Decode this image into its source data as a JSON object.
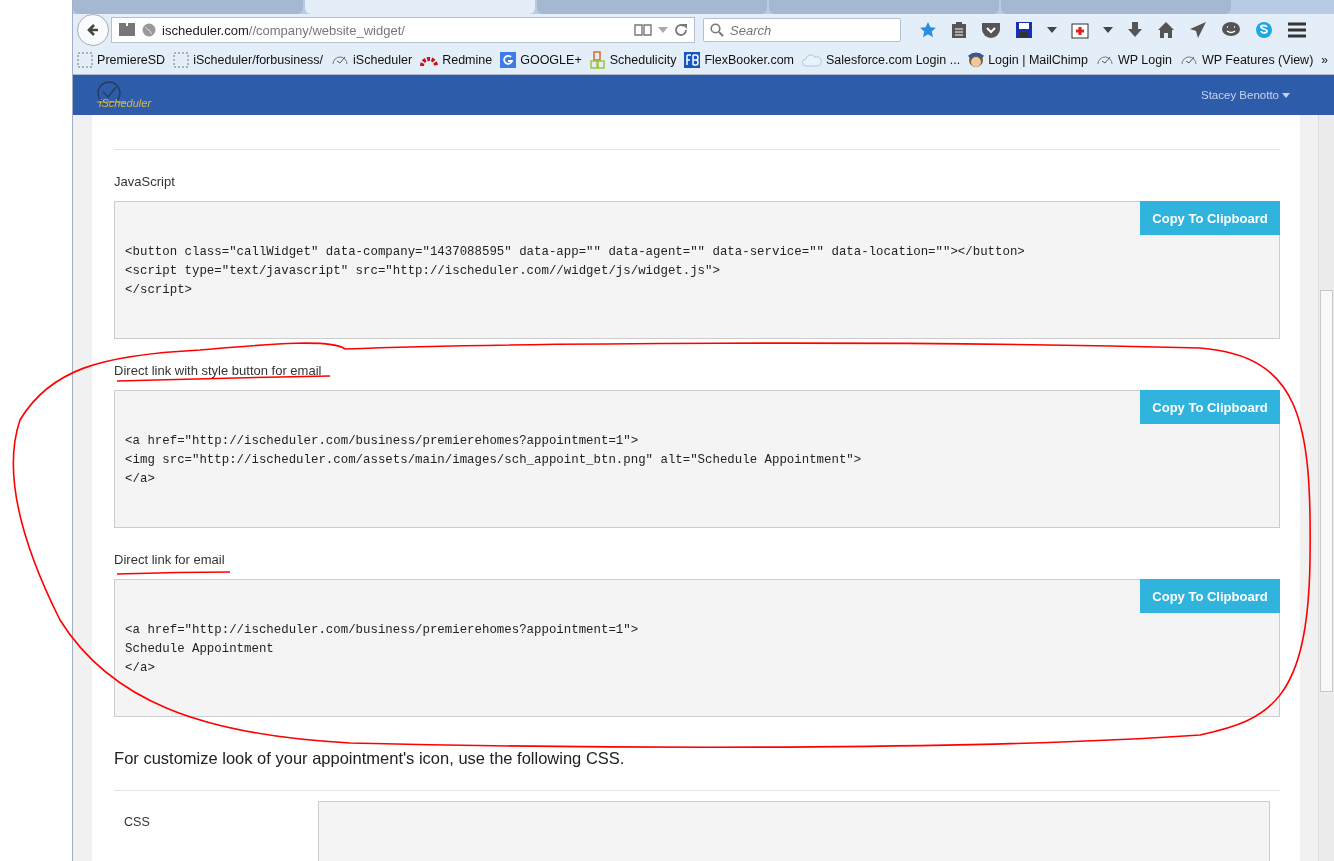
{
  "browser": {
    "tabs": [
      {
        "selected": false
      },
      {
        "selected": true
      },
      {
        "selected": false
      },
      {
        "selected": false
      },
      {
        "selected": false
      }
    ],
    "url_host": "ischeduler.com",
    "url_path": "//company/website_widget/",
    "search_placeholder": "Search",
    "bookmarks": [
      {
        "label": "PremiereSD",
        "kind": "page"
      },
      {
        "label": "iScheduler/forbusiness/",
        "kind": "page"
      },
      {
        "label": "iScheduler",
        "kind": "gauge"
      },
      {
        "label": "Redmine",
        "kind": "arc"
      },
      {
        "label": "GOOGLE+",
        "kind": "google"
      },
      {
        "label": "Schedulicity",
        "kind": "blocks"
      },
      {
        "label": "FlexBooker.com",
        "kind": "fb"
      },
      {
        "label": "Salesforce.com Login ...",
        "kind": "cloud"
      },
      {
        "label": "Login | MailChimp",
        "kind": "chimp"
      },
      {
        "label": "WP Login",
        "kind": "gauge"
      },
      {
        "label": "WP Features (View)",
        "kind": "gauge"
      }
    ],
    "overflow": "»"
  },
  "header": {
    "logo": "iScheduler",
    "user": "Stacey Benotto"
  },
  "sections": [
    {
      "label": "JavaScript",
      "button": "Copy To Clipboard",
      "code": [
        "<button class=\"callWidget\" data-company=\"1437088595\" data-app=\"\" data-agent=\"\" data-service=\"\" data-location=\"\"></button>",
        "<script type=\"text/javascript\" src=\"http://ischeduler.com//widget/js/widget.js\">",
        "</script>"
      ]
    },
    {
      "label": "Direct link with style button for email",
      "button": "Copy To Clipboard",
      "code": [
        "<a href=\"http://ischeduler.com/business/premierehomes?appointment=1\">",
        "<img src=\"http://ischeduler.com/assets/main/images/sch_appoint_btn.png\" alt=\"Schedule Appointment\">",
        "</a>"
      ]
    },
    {
      "label": "Direct link for email",
      "button": "Copy To Clipboard",
      "code": [
        "<a href=\"http://ischeduler.com/business/premierehomes?appointment=1\">",
        "Schedule Appointment",
        "</a>"
      ]
    }
  ],
  "css_note": "For customize look of your appointment's icon, use the following CSS.",
  "css_label": "CSS"
}
